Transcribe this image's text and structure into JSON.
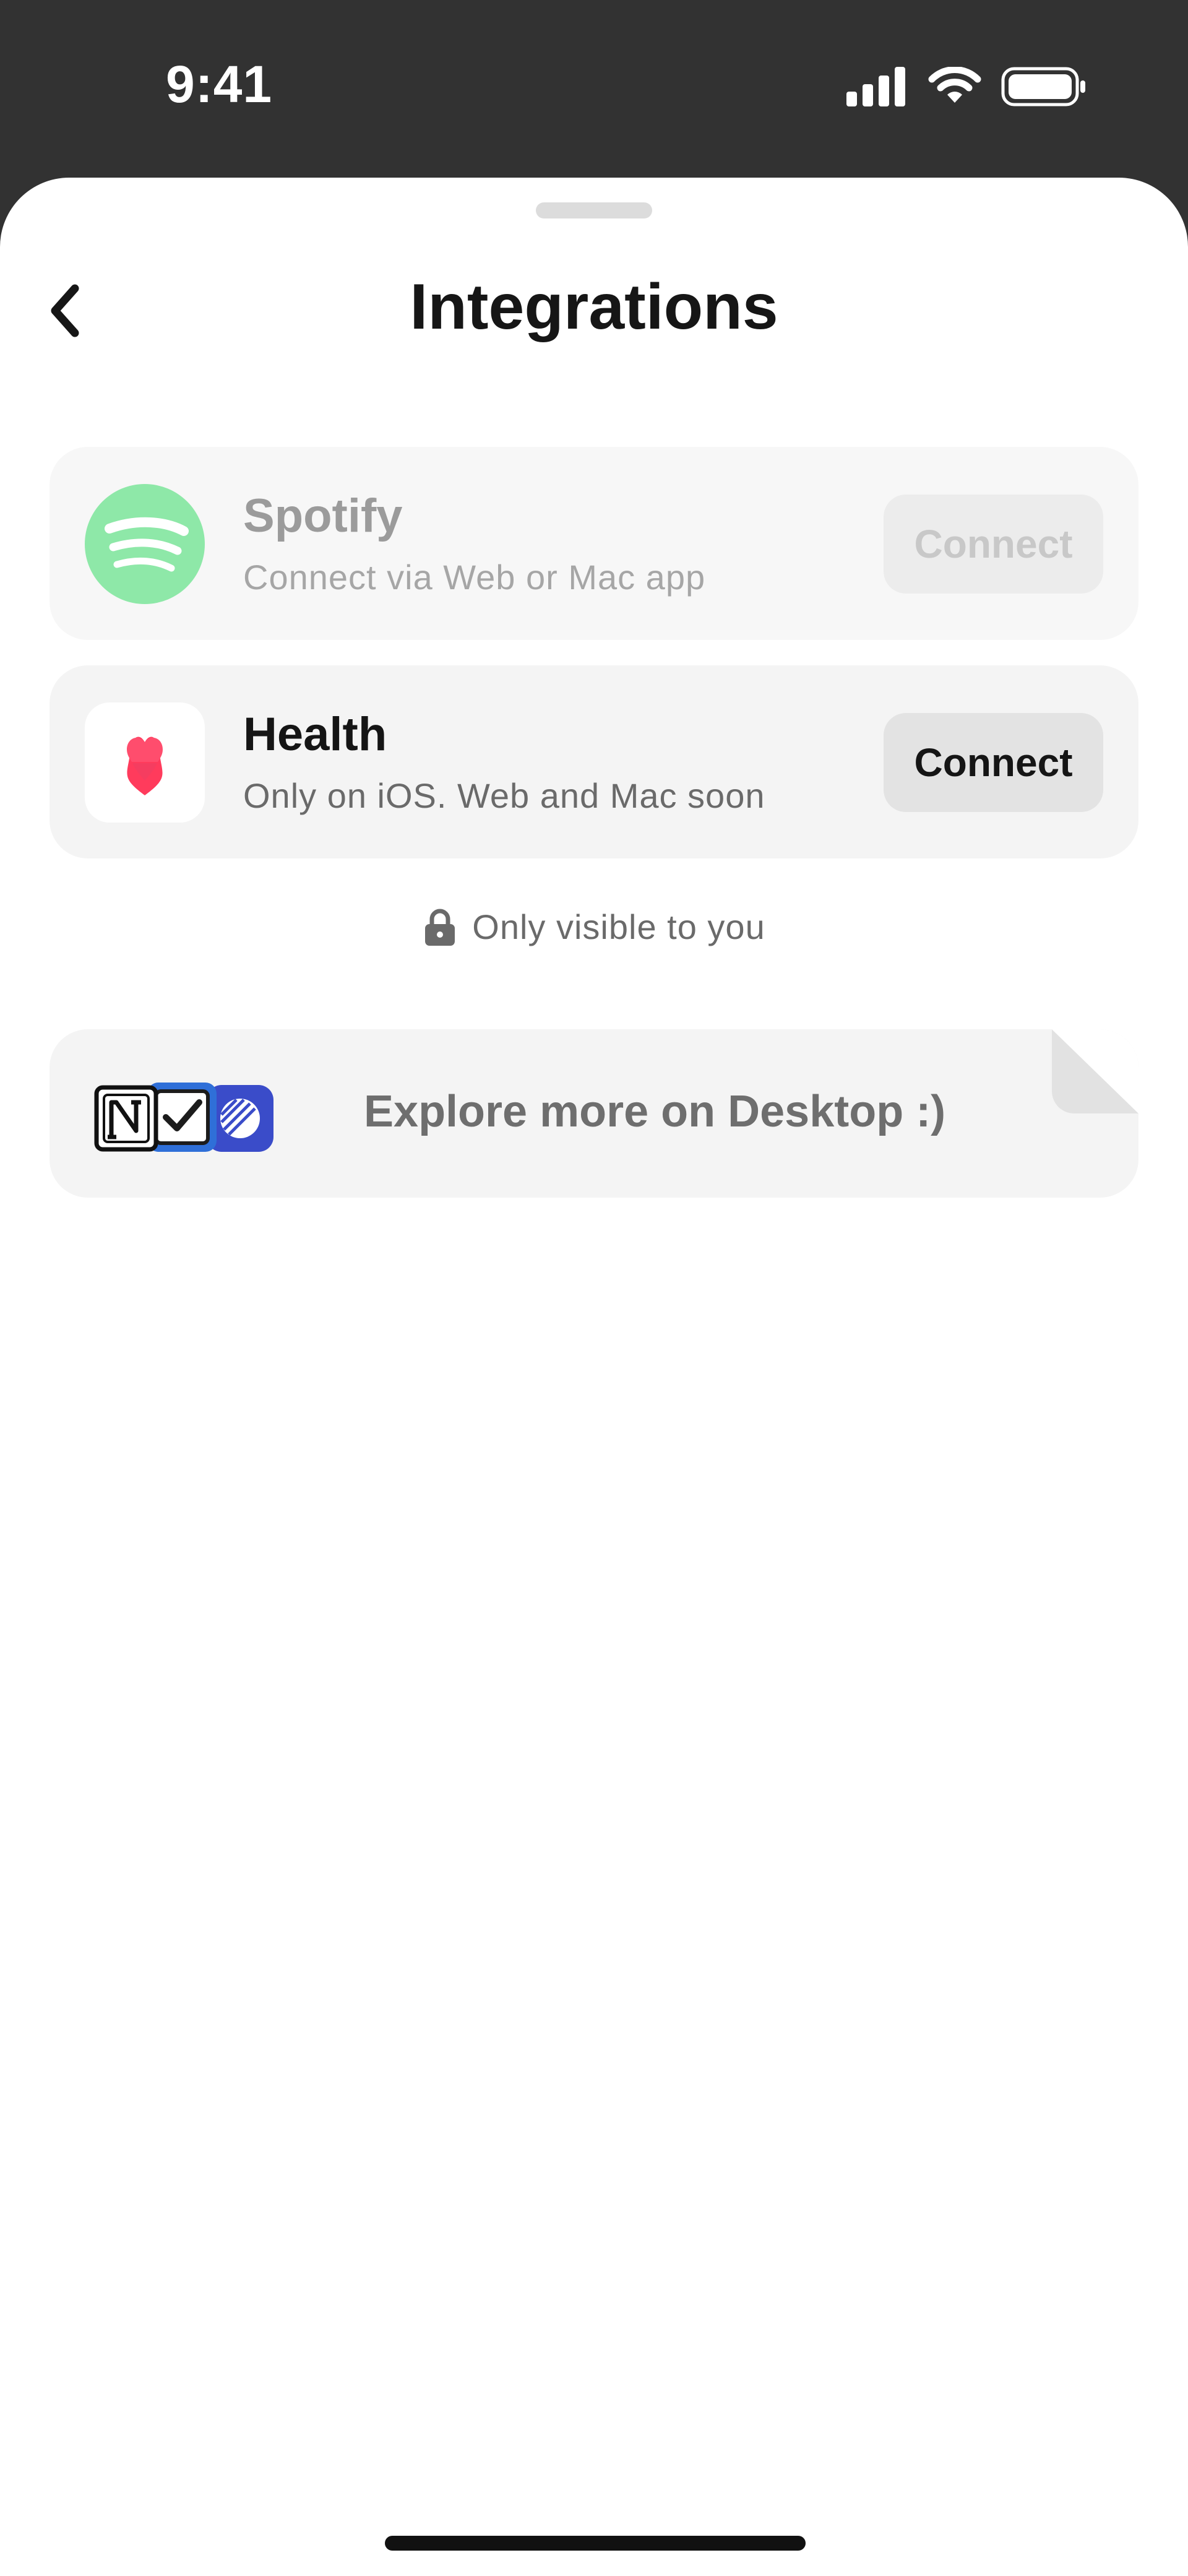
{
  "status_bar": {
    "time": "9:41"
  },
  "header": {
    "title": "Integrations"
  },
  "integrations": [
    {
      "name": "Spotify",
      "subtitle": "Connect via Web or Mac app",
      "button": "Connect",
      "icon": "spotify-icon",
      "color": "#8EE8A8",
      "state": "disabled"
    },
    {
      "name": "Health",
      "subtitle": "Only on iOS. Web and Mac soon",
      "button": "Connect",
      "icon": "heart-icon",
      "color": "#FF3B5C",
      "state": "enabled"
    }
  ],
  "privacy_note": {
    "text": "Only visible to you",
    "icon": "lock-icon"
  },
  "desktop_card": {
    "text": "Explore more on Desktop :)",
    "icons": [
      "notion-icon",
      "checkbox-app-icon",
      "linear-icon"
    ]
  }
}
